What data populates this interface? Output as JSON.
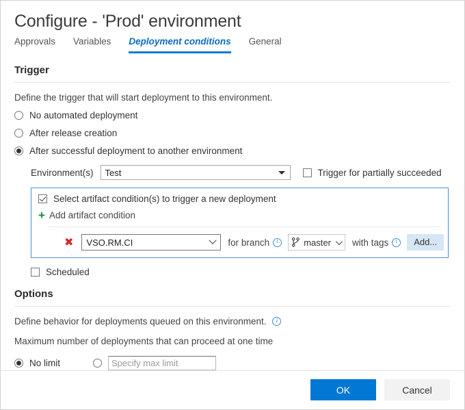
{
  "dialog": {
    "title": "Configure - 'Prod' environment"
  },
  "tabs": [
    {
      "label": "Approvals",
      "active": false
    },
    {
      "label": "Variables",
      "active": false
    },
    {
      "label": "Deployment conditions",
      "active": true
    },
    {
      "label": "General",
      "active": false
    }
  ],
  "trigger": {
    "heading": "Trigger",
    "description": "Define the trigger that will start deployment to this environment.",
    "options": [
      {
        "label": "No automated deployment",
        "selected": false
      },
      {
        "label": "After release creation",
        "selected": false
      },
      {
        "label": "After successful deployment to another environment",
        "selected": true
      }
    ],
    "environment": {
      "label": "Environment(s)",
      "value": "Test"
    },
    "partially_succeeded": {
      "label": "Trigger for partially succeeded",
      "checked": false
    },
    "artifact_condition": {
      "select_label": "Select artifact condition(s) to trigger a new deployment",
      "select_checked": true,
      "add_label": "Add artifact condition",
      "add_icon": "plus-icon",
      "rows": [
        {
          "remove_icon": "remove-x-icon",
          "artifact": "VSO.RM.CI",
          "for_branch_label": "for branch",
          "for_branch_info_icon": "info-icon",
          "branch_icon": "branch-icon",
          "branch": "master",
          "with_tags_label": "with tags",
          "with_tags_info_icon": "info-icon",
          "add_tags_label": "Add..."
        }
      ]
    },
    "scheduled": {
      "label": "Scheduled",
      "checked": false
    }
  },
  "options": {
    "heading": "Options",
    "description": "Define behavior for deployments queued on this environment.",
    "description_info_icon": "info-icon",
    "max_label": "Maximum number of deployments that can proceed at one time",
    "no_limit": {
      "label": "No limit",
      "selected": true
    },
    "specify": {
      "selected": false,
      "value": "",
      "placeholder": "Specify max limit"
    }
  },
  "footer": {
    "ok_label": "OK",
    "cancel_label": "Cancel"
  },
  "colors": {
    "accent": "#0078d4",
    "tab_active": "#0a6cc4",
    "panel_border": "#4a90d9",
    "plus_green": "#1d8a3b",
    "remove_red": "#d8232a",
    "info_blue": "#3b8ede",
    "add_button_bg": "#d6e6f4"
  }
}
